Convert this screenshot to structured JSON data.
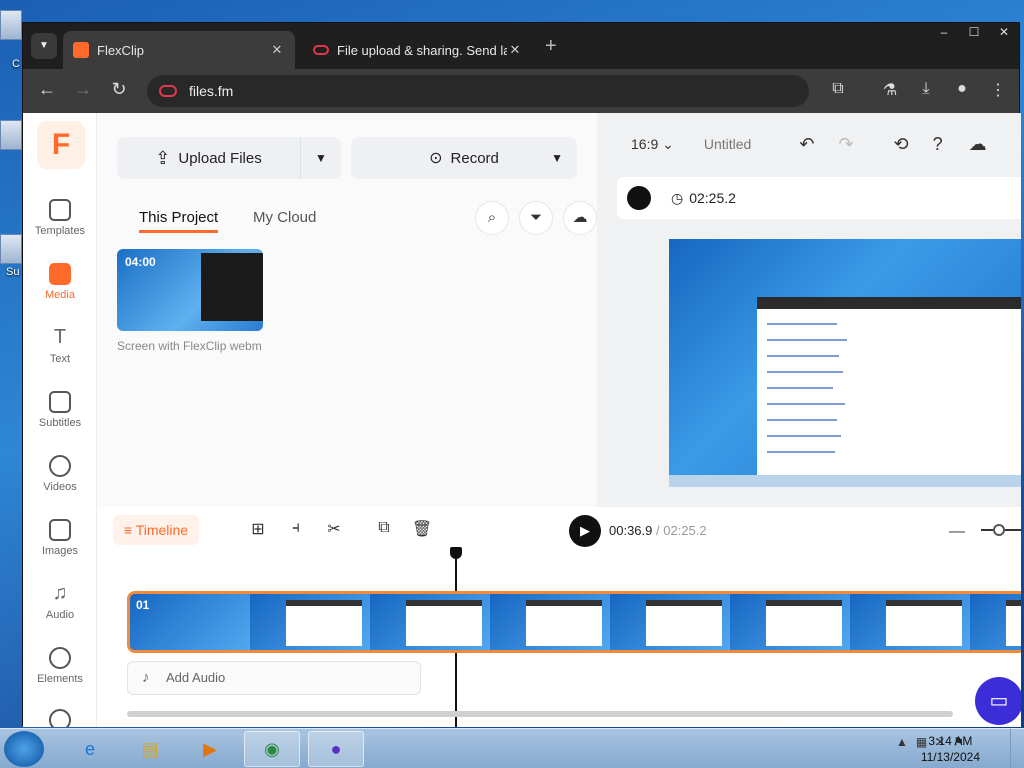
{
  "desktop": {
    "labels": [
      "C",
      "Su"
    ]
  },
  "browser": {
    "tabs": [
      {
        "title": "FlexClip",
        "active": true
      },
      {
        "title": "File upload & sharing. Send large",
        "active": false
      }
    ],
    "address": "files.fm",
    "window_controls": [
      "–",
      "☐",
      "✕"
    ]
  },
  "app": {
    "sidebar": [
      {
        "label": "Templates",
        "icon": "templates-icon"
      },
      {
        "label": "Media",
        "icon": "media-icon",
        "active": true
      },
      {
        "label": "Text",
        "icon": "text-icon"
      },
      {
        "label": "Subtitles",
        "icon": "subtitles-icon"
      },
      {
        "label": "Videos",
        "icon": "videos-icon"
      },
      {
        "label": "Images",
        "icon": "images-icon"
      },
      {
        "label": "Audio",
        "icon": "audio-icon"
      },
      {
        "label": "Elements",
        "icon": "elements-icon"
      }
    ],
    "media": {
      "upload_label": "Upload Files",
      "record_label": "Record",
      "tabs": [
        "This Project",
        "My Cloud"
      ],
      "thumb_duration": "04:00",
      "thumb_caption": "Screen with FlexClip webm"
    },
    "preview": {
      "ratio": "16:9",
      "title": "Untitled",
      "duration": "02:25.2"
    },
    "timeline": {
      "label": "Timeline",
      "current": "00:36.9",
      "total": "02:25.2",
      "clip_number": "01",
      "add_audio": "Add Audio"
    }
  },
  "taskbar": {
    "time": "3:14 AM",
    "date": "11/13/2024"
  },
  "colors": {
    "accent": "#ff6a2a",
    "chat": "#3b2dd8"
  }
}
